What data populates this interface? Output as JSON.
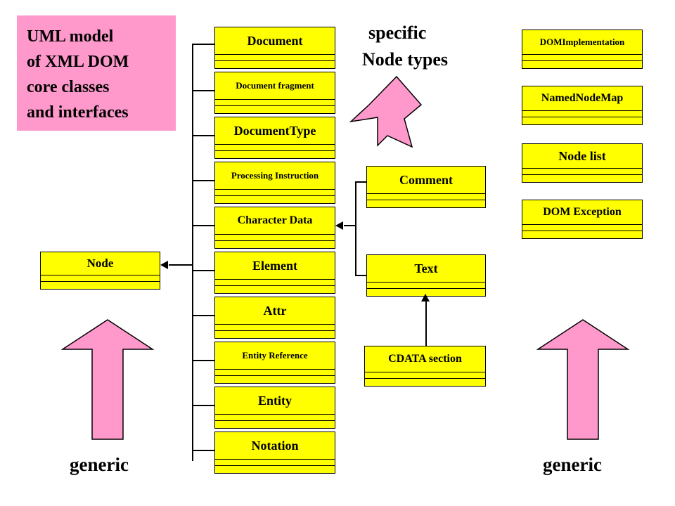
{
  "title_box": {
    "lines": [
      "UML model",
      "of XML DOM",
      "core classes",
      "and interfaces"
    ],
    "background_color": "#FF99CC"
  },
  "colors": {
    "class_fill": "#FFFF00",
    "class_border": "#000000",
    "pink": "#FF99CC",
    "background": "#FFFFFF"
  },
  "headings": {
    "specific_line1": "specific",
    "specific_line2": "Node types",
    "generic_left": "generic",
    "generic_right": "generic"
  },
  "base_class": {
    "name": "Node"
  },
  "node_subclasses": [
    {
      "name": "Document",
      "size": "large"
    },
    {
      "name": "Document fragment",
      "size": "small"
    },
    {
      "name": "DocumentType",
      "size": "large"
    },
    {
      "name": "Processing Instruction",
      "size": "small"
    },
    {
      "name": "Character Data",
      "size": "medium"
    },
    {
      "name": "Element",
      "size": "large"
    },
    {
      "name": "Attr",
      "size": "large"
    },
    {
      "name": "Entity Reference",
      "size": "small"
    },
    {
      "name": "Entity",
      "size": "large"
    },
    {
      "name": "Notation",
      "size": "large"
    }
  ],
  "character_data_subclasses": [
    {
      "name": "Comment",
      "size": "large"
    },
    {
      "name": "Text",
      "size": "large"
    }
  ],
  "text_subclasses": [
    {
      "name": "CDATA section",
      "size": "medium"
    }
  ],
  "support_classes": [
    {
      "name": "DOMImplementation",
      "size": "small"
    },
    {
      "name": "NamedNodeMap",
      "size": "medium"
    },
    {
      "name": "Node list",
      "size": "large"
    },
    {
      "name": "DOM Exception",
      "size": "medium"
    }
  ]
}
